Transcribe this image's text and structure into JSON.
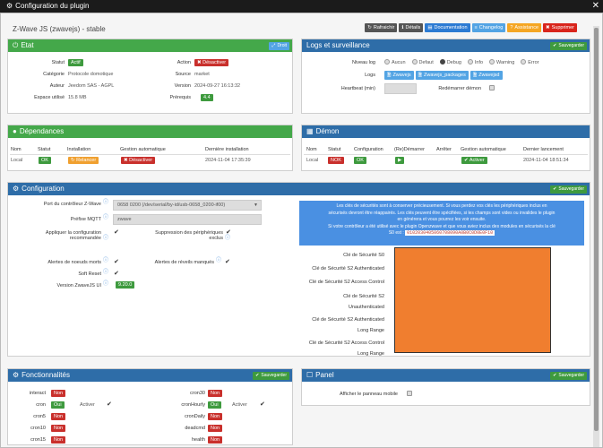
{
  "window": {
    "title": "Configuration du plugin"
  },
  "plugin": {
    "title": "Z-Wave JS (zwavejs) - stable"
  },
  "toolbar": {
    "refresh": "Rafraichir",
    "details": "Détails",
    "doc": "Documentation",
    "changelog": "Changelog",
    "assistance": "Assistance",
    "delete": "Supprimer"
  },
  "etat": {
    "title": "Etat",
    "button": "Droit",
    "statut_label": "Statut",
    "statut_value": "Actif",
    "action_label": "Action",
    "action_value": "Désactiver",
    "categorie_label": "Catégorie",
    "categorie_value": "Protocole domotique",
    "source_label": "Source",
    "source_value": "market",
    "auteur_label": "Auteur",
    "auteur_value": "Jeedom SAS - AGPL",
    "version_label": "Version",
    "version_value": "2024-09-27 16:13:32",
    "espace_label": "Espace utilisé",
    "espace_value": "15.8 MB",
    "prerequis_label": "Prérequis",
    "prerequis_value": "4.4"
  },
  "logs": {
    "title": "Logs et surveillance",
    "save": "Sauvegarder",
    "niveau_label": "Niveau log",
    "niveaux": [
      "Aucun",
      "Defaut",
      "Debug",
      "Info",
      "Warning",
      "Error"
    ],
    "logs_label": "Logs",
    "log_buttons": [
      "Zwavejs",
      "Zwavejs_packages",
      "Zwavejsd"
    ],
    "heartbeat_label": "Heartbeat (min)",
    "redemarrer_label": "Redémarrer démon"
  },
  "dependances": {
    "title": "Dépendances",
    "headers": [
      "Nom",
      "Statut",
      "Installation",
      "Gestion automatique",
      "Dernière installation"
    ],
    "row": {
      "nom": "Local",
      "statut": "OK",
      "installation": "Relancer",
      "gestion": "Désactiver",
      "derniere": "2024-11-04 17:35:39"
    }
  },
  "demon": {
    "title": "Démon",
    "headers": [
      "Nom",
      "Statut",
      "Configuration",
      "(Re)Démarrer",
      "Arrêter",
      "Gestion automatique",
      "Dernier lancement"
    ],
    "row": {
      "nom": "Local",
      "statut": "NOK",
      "configuration": "OK",
      "gestion": "Activer",
      "dernier": "2024-11-04 18:51:34"
    }
  },
  "configuration": {
    "title": "Configuration",
    "save": "Sauvegarder",
    "port_label": "Port du contrôleur Z-Wave",
    "port_value": "0658 0200 (/dev/serial/by-id/usb-0658_0200-if00)",
    "mqtt_label": "Préfixe MQTT",
    "mqtt_value": "zwave",
    "appliquer_label_1": "Appliquer la configuration",
    "appliquer_label_2": "recommandée",
    "suppression_label_1": "Suppression des périphériques",
    "suppression_label_2": "exclus",
    "alertes_morts_label": "Alertes de noeuds morts",
    "alertes_reveil_label": "Alertes de réveils manqués",
    "soft_reset_label": "Soft Reset",
    "version_label": "Version ZwaveJS UI",
    "version_value": "9.20.0",
    "info_lines": [
      "Les clés de sécurités sont à conserver précieusement. Si vous perdez vos clés les périphériques inclus en",
      "sécurisés devront être réappairés. Les clés peuvent être spécifiées, si les champs sont vides ou invalides le plugin",
      "en générera et vous pourrez les voir ensuite.",
      "Si votre contrôleur a été utilisé avec le plugin Openzwave et que vous aviez inclus des modules en sécurisés la clé"
    ],
    "s0_prefix": "S0 est :",
    "s0_key": "0102030405060708090A0B0C0D0E0F10",
    "keys": [
      "Clé de Sécurité S0",
      "Clé de Sécurité S2 Authenticated",
      "Clé de Sécurité S2 Access Control",
      "Clé de Sécurité S2",
      "Unauthenticated",
      "Clé de Sécurité S2 Authenticated",
      "Long Range",
      "Clé de Sécurité S2 Access Control",
      "Long Range"
    ],
    "redact_color": "#f07e2f"
  },
  "fonctionnalites": {
    "title": "Fonctionnalités",
    "save": "Sauvegarder",
    "left": [
      {
        "name": "interact",
        "status": "Non",
        "active": false
      },
      {
        "name": "cron",
        "status": "Oui",
        "active": true,
        "activer": "Activer"
      },
      {
        "name": "cron5",
        "status": "Non",
        "active": false
      },
      {
        "name": "cron10",
        "status": "Non",
        "active": false
      },
      {
        "name": "cron15",
        "status": "Non",
        "active": false
      }
    ],
    "right": [
      {
        "name": "cron30",
        "status": "Non",
        "active": false
      },
      {
        "name": "cronHourly",
        "status": "Oui",
        "active": true,
        "activer": "Activer"
      },
      {
        "name": "cronDaily",
        "status": "Non",
        "active": false
      },
      {
        "name": "deadcmd",
        "status": "Non",
        "active": false
      },
      {
        "name": "health",
        "status": "Non",
        "active": false
      }
    ]
  },
  "panel": {
    "title": "Panel",
    "save": "Sauvegarder",
    "afficher_label": "Afficher le panneau mobile"
  }
}
